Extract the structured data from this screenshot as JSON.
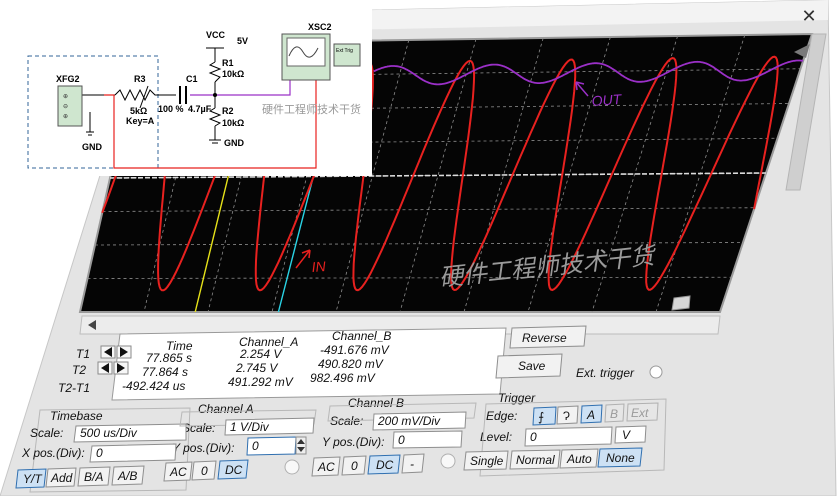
{
  "window": {
    "close_glyph": "✕"
  },
  "schematic": {
    "fxg": "XFG2",
    "r3": "R3",
    "r3_val": "5kΩ",
    "key": "Key=A",
    "pct": "100 %",
    "c1": "C1",
    "c1_val": "4.7µF",
    "vcc": "VCC",
    "vcc_val": "5V",
    "r1": "R1",
    "r1_val": "10kΩ",
    "r2": "R2",
    "r2_val": "10kΩ",
    "gnd1": "GND",
    "gnd2": "GND",
    "xsc": "XSC2",
    "ext_trig": "Ext Trig",
    "watermark": "硬件工程师技术干货"
  },
  "scope": {
    "out_label": "OUT",
    "in_label": "IN",
    "watermark": "硬件工程师技术干货",
    "colors": {
      "screen": "#000000",
      "in": "#e8211f",
      "out": "#9b30c8",
      "t1": "#e6e219",
      "t2": "#2ad4e6",
      "grid": "#8c8c8c"
    }
  },
  "readout": {
    "headers": [
      "Time",
      "Channel_A",
      "Channel_B"
    ],
    "rows": [
      {
        "label": "T1",
        "time": "77.865 s",
        "a": "2.254 V",
        "b": "-491.676 mV"
      },
      {
        "label": "T2",
        "time": "77.864 s",
        "a": "2.745 V",
        "b": "490.820 mV"
      },
      {
        "label": "T2-T1",
        "time": "-492.424 us",
        "a": "491.292 mV",
        "b": "982.496 mV"
      }
    ],
    "reverse": "Reverse",
    "save": "Save",
    "ext_trigger": "Ext. trigger"
  },
  "timebase": {
    "title": "Timebase",
    "scale_label": "Scale:",
    "scale": "500 us/Div",
    "xpos_label": "X pos.(Div):",
    "xpos": "0",
    "modes": [
      "Y/T",
      "Add",
      "B/A",
      "A/B"
    ]
  },
  "channel_a": {
    "title": "Channel A",
    "scale_label": "Scale:",
    "scale": "1 V/Div",
    "ypos_label": "Y pos.(Div):",
    "ypos": "0",
    "coupling": [
      "AC",
      "0",
      "DC"
    ]
  },
  "channel_b": {
    "title": "Channel B",
    "scale_label": "Scale:",
    "scale": "200 mV/Div",
    "ypos_label": "Y pos.(Div):",
    "ypos": "0",
    "coupling": [
      "AC",
      "0",
      "DC",
      "-"
    ]
  },
  "trigger": {
    "title": "Trigger",
    "edge_label": "Edge:",
    "edge_buttons": [
      "A",
      "B",
      "Ext"
    ],
    "level_label": "Level:",
    "level": "0",
    "level_unit": "V",
    "modes": [
      "Single",
      "Normal",
      "Auto",
      "None"
    ]
  }
}
